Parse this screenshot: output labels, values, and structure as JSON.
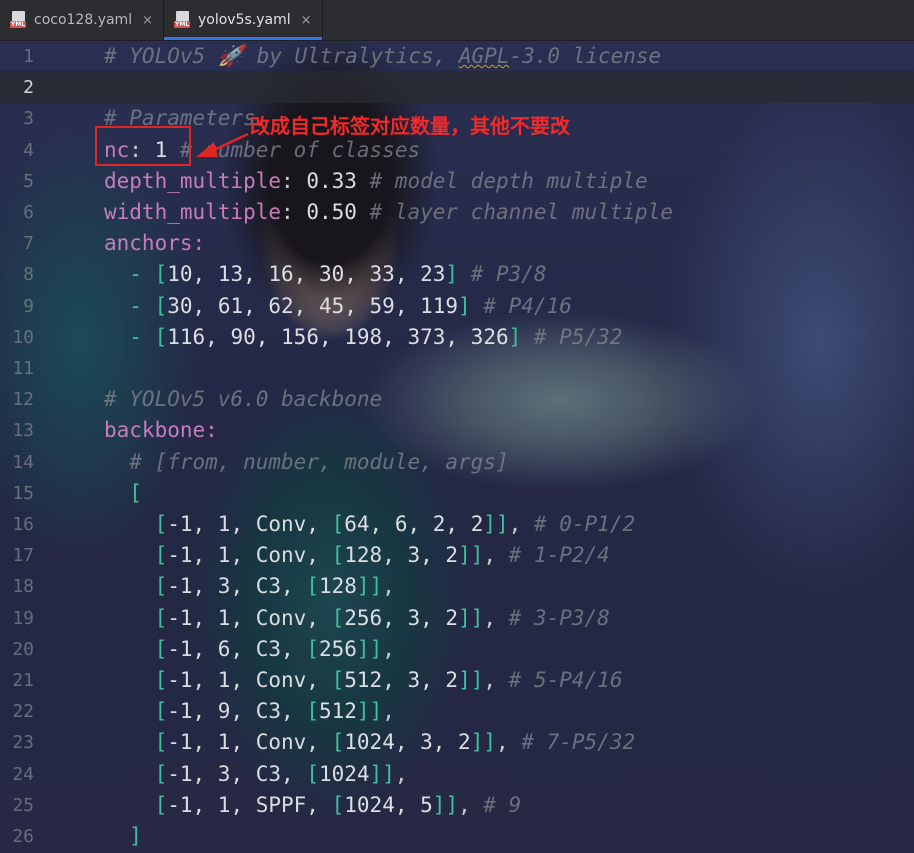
{
  "tabs": [
    {
      "name": "coco128.yaml",
      "icon": "yaml-file-icon",
      "badge": "YML",
      "close": "×",
      "active": false
    },
    {
      "name": "yolov5s.yaml",
      "icon": "yaml-file-icon",
      "badge": "YML",
      "close": "×",
      "active": true
    }
  ],
  "editor": {
    "current_line": 2,
    "line_numbers": [
      "1",
      "2",
      "3",
      "4",
      "5",
      "6",
      "7",
      "8",
      "9",
      "10",
      "11",
      "12",
      "13",
      "14",
      "15",
      "16",
      "17",
      "18",
      "19",
      "20",
      "21",
      "22",
      "23",
      "24",
      "25",
      "26"
    ]
  },
  "annotation": {
    "text": "改成自己标签对应数量，其他不要改",
    "color": "#e02525"
  },
  "code": {
    "l1": {
      "c_a": "# YOLOv5 ",
      "rocket": "🚀",
      "c_b": " by Ultralytics, ",
      "c_lic": "AGPL",
      "c_c": "-3.0 license"
    },
    "l3": {
      "c": "# Parameters"
    },
    "l4": {
      "k": "nc",
      "p": ": ",
      "v": "1",
      "c": " # number of classes"
    },
    "l5": {
      "k": "depth_multiple",
      "p": ": ",
      "v": "0.33",
      "c": " # model depth multiple"
    },
    "l6": {
      "k": "width_multiple",
      "p": ": ",
      "v": "0.50",
      "c": " # layer channel multiple"
    },
    "l7": {
      "k": "anchors",
      "p": ":"
    },
    "l8": {
      "indent": "  ",
      "dash": "- ",
      "ob": "[",
      "body": "10, 13, 16, 30, 33, 23",
      "cb": "]",
      "c": " # P3/8"
    },
    "l9": {
      "indent": "  ",
      "dash": "- ",
      "ob": "[",
      "body": "30, 61, 62, 45, 59, 119",
      "cb": "]",
      "c": " # P4/16"
    },
    "l10": {
      "indent": "  ",
      "dash": "- ",
      "ob": "[",
      "body": "116, 90, 156, 198, 373, 326",
      "cb": "]",
      "c": " # P5/32"
    },
    "l12": {
      "c": "# YOLOv5 v6.0 backbone"
    },
    "l13": {
      "k": "backbone",
      "p": ":"
    },
    "l14": {
      "indent": "  ",
      "c": "# [from, number, module, args]"
    },
    "l15": {
      "indent": "  ",
      "ob": "["
    },
    "l16": {
      "indent": "    ",
      "ob": "[",
      "body": "-1, 1, Conv, ",
      "ob2": "[",
      "args": "64, 6, 2, 2",
      "cb2": "]",
      "cb": "]",
      "tail": ",",
      "c": " # 0-P1/2"
    },
    "l17": {
      "indent": "    ",
      "ob": "[",
      "body": "-1, 1, Conv, ",
      "ob2": "[",
      "args": "128, 3, 2",
      "cb2": "]",
      "cb": "]",
      "tail": ",",
      "c": " # 1-P2/4"
    },
    "l18": {
      "indent": "    ",
      "ob": "[",
      "body": "-1, 3, C3, ",
      "ob2": "[",
      "args": "128",
      "cb2": "]",
      "cb": "]",
      "tail": ",",
      "c": ""
    },
    "l19": {
      "indent": "    ",
      "ob": "[",
      "body": "-1, 1, Conv, ",
      "ob2": "[",
      "args": "256, 3, 2",
      "cb2": "]",
      "cb": "]",
      "tail": ",",
      "c": " # 3-P3/8"
    },
    "l20": {
      "indent": "    ",
      "ob": "[",
      "body": "-1, 6, C3, ",
      "ob2": "[",
      "args": "256",
      "cb2": "]",
      "cb": "]",
      "tail": ",",
      "c": ""
    },
    "l21": {
      "indent": "    ",
      "ob": "[",
      "body": "-1, 1, Conv, ",
      "ob2": "[",
      "args": "512, 3, 2",
      "cb2": "]",
      "cb": "]",
      "tail": ",",
      "c": " # 5-P4/16"
    },
    "l22": {
      "indent": "    ",
      "ob": "[",
      "body": "-1, 9, C3, ",
      "ob2": "[",
      "args": "512",
      "cb2": "]",
      "cb": "]",
      "tail": ",",
      "c": ""
    },
    "l23": {
      "indent": "    ",
      "ob": "[",
      "body": "-1, 1, Conv, ",
      "ob2": "[",
      "args": "1024, 3, 2",
      "cb2": "]",
      "cb": "]",
      "tail": ",",
      "c": " # 7-P5/32"
    },
    "l24": {
      "indent": "    ",
      "ob": "[",
      "body": "-1, 3, C3, ",
      "ob2": "[",
      "args": "1024",
      "cb2": "]",
      "cb": "]",
      "tail": ",",
      "c": ""
    },
    "l25": {
      "indent": "    ",
      "ob": "[",
      "body": "-1, 1, SPPF, ",
      "ob2": "[",
      "args": "1024, 5",
      "cb2": "]",
      "cb": "]",
      "tail": ",",
      "c": " # 9"
    },
    "l26": {
      "indent": "  ",
      "cb": "]"
    }
  }
}
